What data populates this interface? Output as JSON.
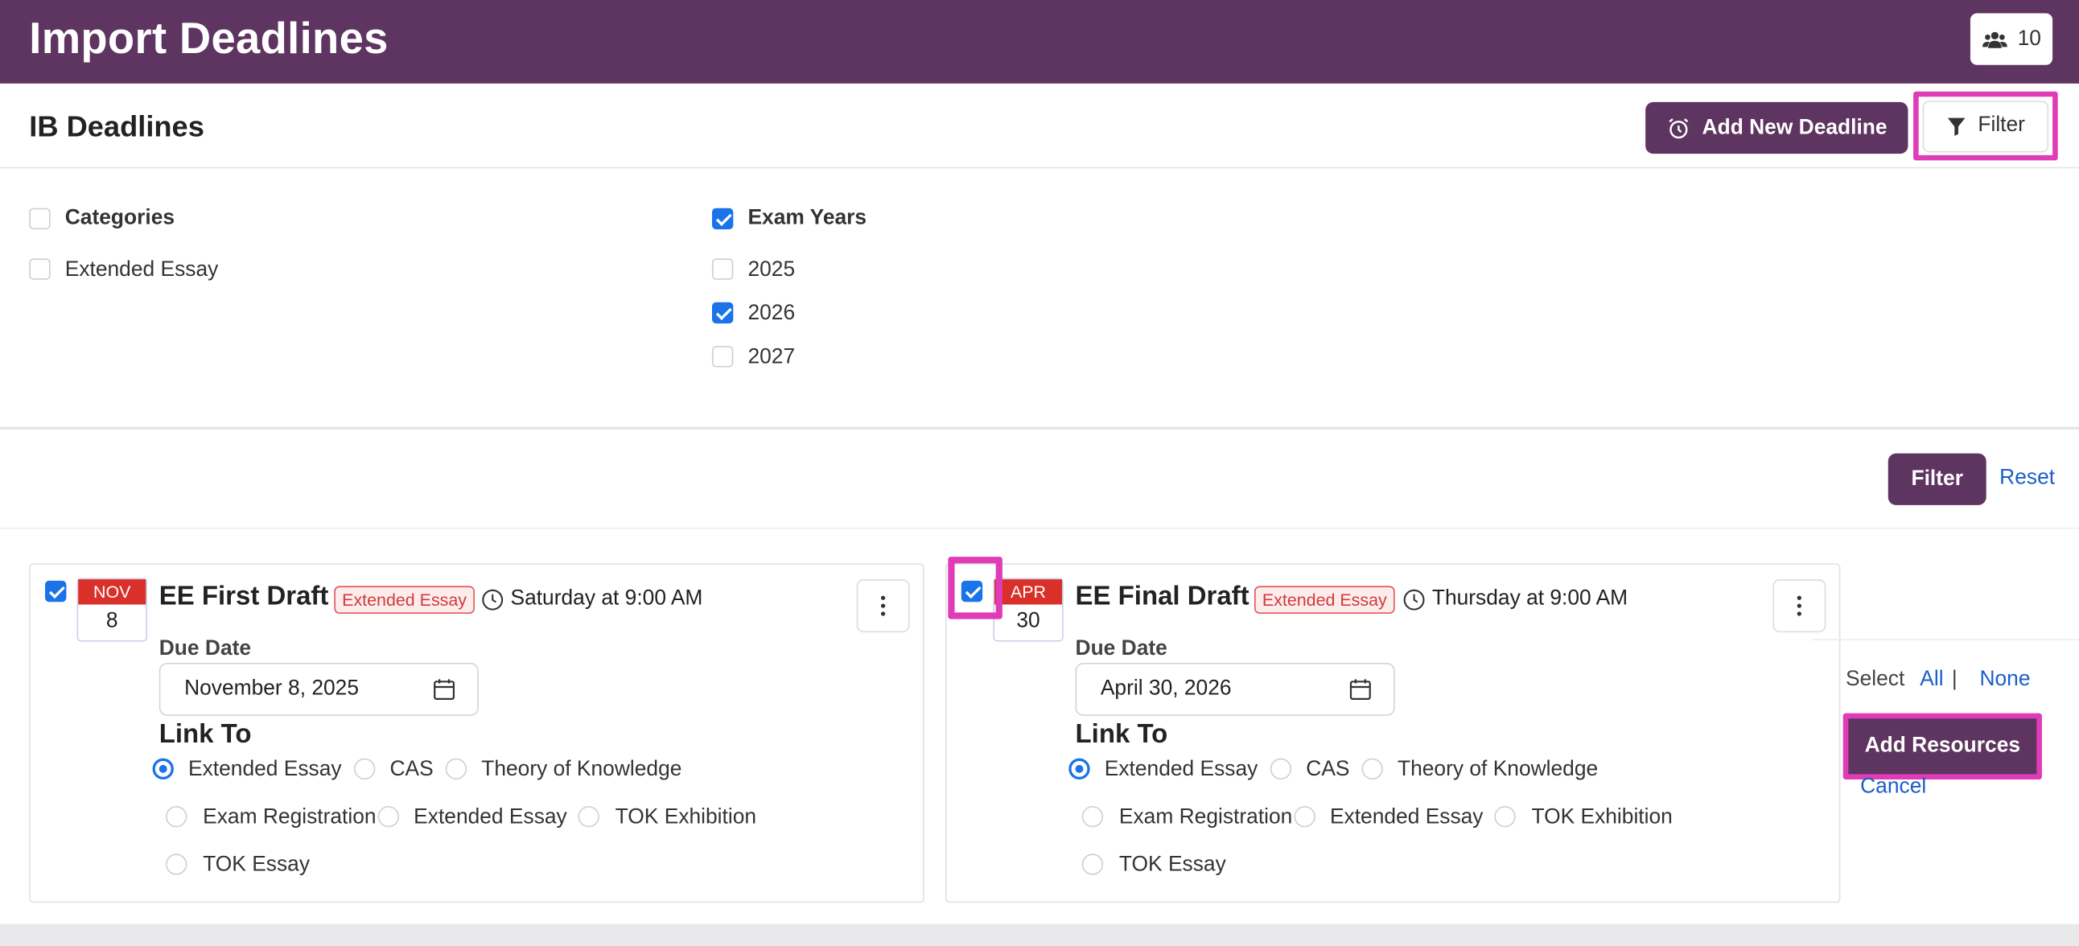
{
  "header": {
    "title": "Import Deadlines",
    "users_count": "10",
    "brand_color": "#5e3460"
  },
  "subheader": {
    "title": "IB Deadlines",
    "add_deadline_label": "Add New Deadline",
    "filter_label": "Filter"
  },
  "filters": {
    "categories": {
      "heading": "Categories",
      "heading_checked": false,
      "items": [
        {
          "label": "Extended Essay",
          "checked": false
        }
      ]
    },
    "exam_years": {
      "heading": "Exam Years",
      "heading_checked": true,
      "items": [
        {
          "label": "2025",
          "checked": false
        },
        {
          "label": "2026",
          "checked": true
        },
        {
          "label": "2027",
          "checked": false
        }
      ]
    },
    "apply_label": "Filter",
    "reset_label": "Reset"
  },
  "deadlines": [
    {
      "checked": true,
      "month": "NOV",
      "day": "8",
      "title": "EE First Draft",
      "tag": "Extended Essay",
      "when": "Saturday at 9:00 AM",
      "due_label": "Due Date",
      "due_date": "November 8, 2025",
      "link_to_label": "Link To",
      "link_options": [
        {
          "label": "Extended Essay",
          "selected": true
        },
        {
          "label": "CAS",
          "selected": false
        },
        {
          "label": "Theory of Knowledge",
          "selected": false
        },
        {
          "label": "Exam Registration",
          "selected": false
        },
        {
          "label": "Extended Essay",
          "selected": false
        },
        {
          "label": "TOK Exhibition",
          "selected": false
        },
        {
          "label": "TOK Essay",
          "selected": false
        }
      ]
    },
    {
      "checked": true,
      "month": "APR",
      "day": "30",
      "title": "EE Final Draft",
      "tag": "Extended Essay",
      "when": "Thursday at 9:00 AM",
      "due_label": "Due Date",
      "due_date": "April 30, 2026",
      "link_to_label": "Link To",
      "link_options": [
        {
          "label": "Extended Essay",
          "selected": true
        },
        {
          "label": "CAS",
          "selected": false
        },
        {
          "label": "Theory of Knowledge",
          "selected": false
        },
        {
          "label": "Exam Registration",
          "selected": false
        },
        {
          "label": "Extended Essay",
          "selected": false
        },
        {
          "label": "TOK Exhibition",
          "selected": false
        },
        {
          "label": "TOK Essay",
          "selected": false
        }
      ]
    }
  ],
  "selection": {
    "select_label": "Select",
    "all_label": "All",
    "separator": "|",
    "none_label": "None",
    "add_resources_label": "Add Resources",
    "cancel_label": "Cancel"
  }
}
